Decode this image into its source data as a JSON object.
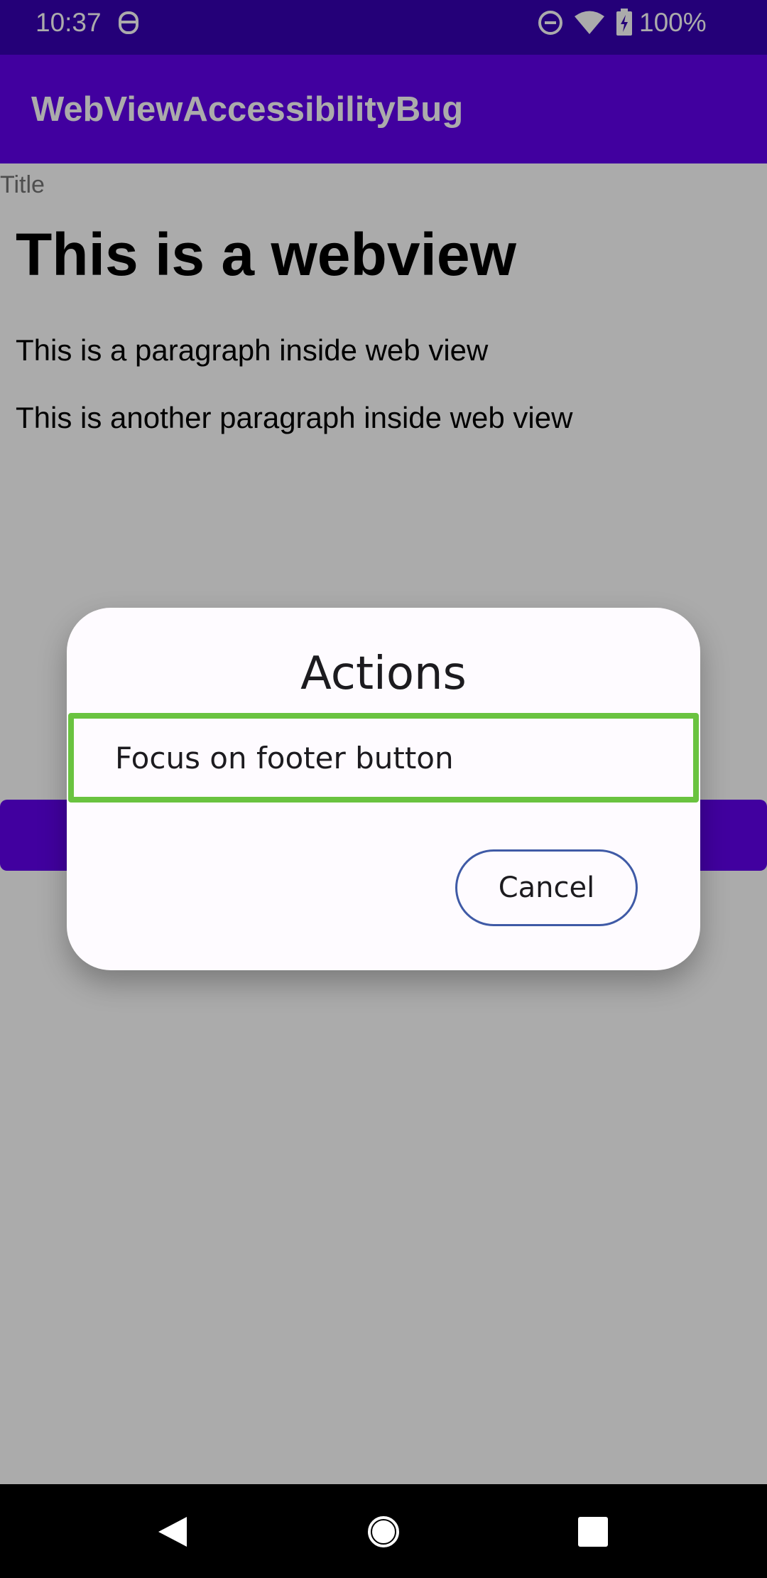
{
  "status_bar": {
    "time": "10:37",
    "battery_text": "100%",
    "icons": [
      "face-icon",
      "do-not-disturb-icon",
      "wifi-icon",
      "battery-charging-icon"
    ]
  },
  "app_bar": {
    "title": "WebViewAccessibilityBug"
  },
  "content": {
    "field_label": "Title",
    "webview": {
      "heading": "This is a webview",
      "paragraphs": [
        "This is a paragraph inside web view",
        "This is another paragraph inside web view"
      ]
    }
  },
  "dialog": {
    "title": "Actions",
    "option_label": "Focus on footer button",
    "cancel_label": "Cancel"
  },
  "nav_bar": {
    "icons": [
      "back-icon",
      "home-icon",
      "recents-icon"
    ]
  },
  "colors": {
    "status_bar": "#3700b3",
    "app_bar": "#6200ee",
    "focus_outline": "#6ac340",
    "cancel_outline": "#3f5aa6"
  }
}
